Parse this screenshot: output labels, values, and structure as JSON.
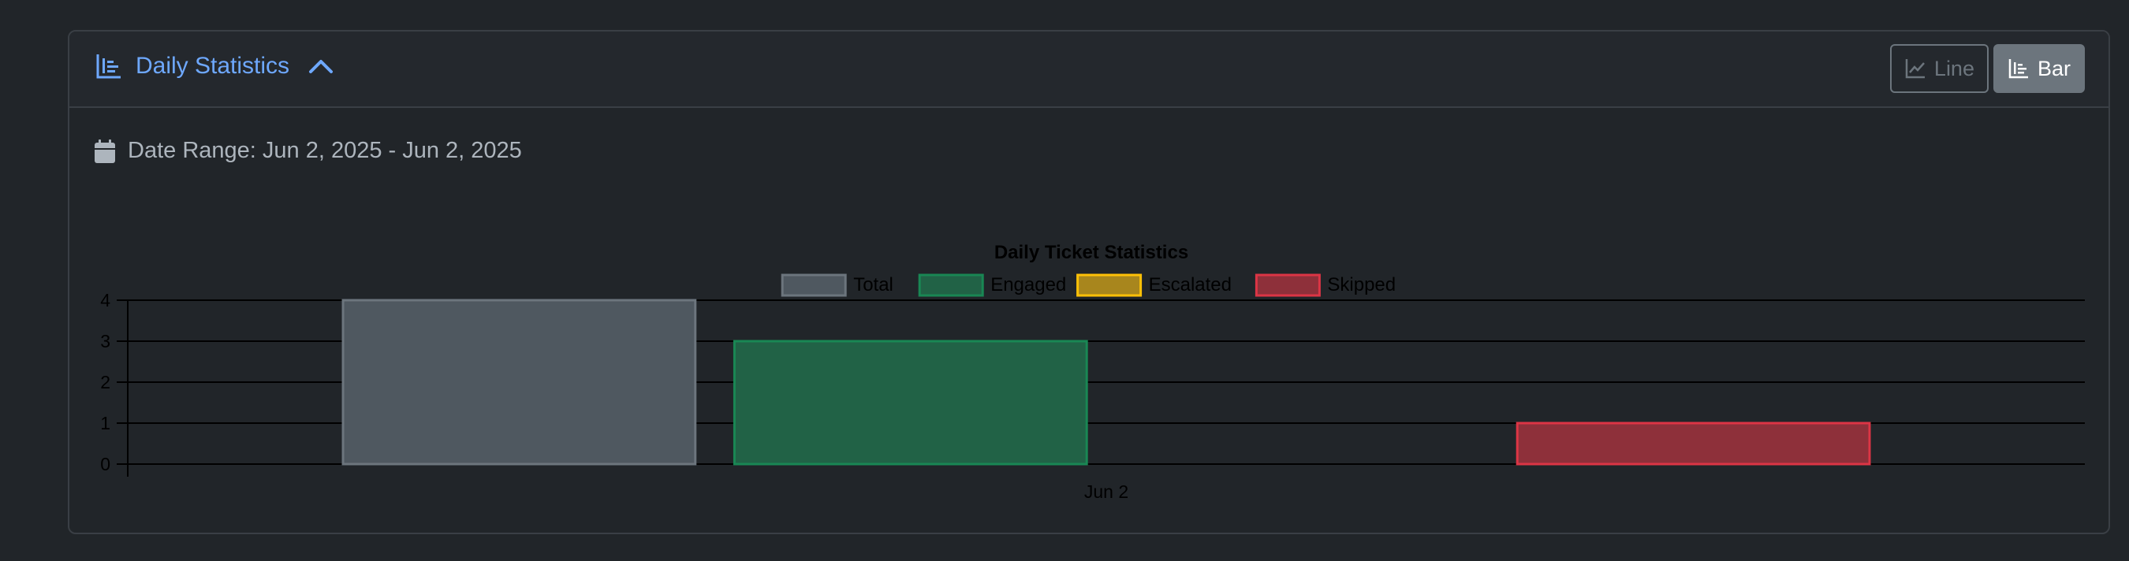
{
  "header": {
    "title": "Daily Statistics",
    "buttons": {
      "line_label": "Line",
      "bar_label": "Bar",
      "active": "bar"
    }
  },
  "date_range": {
    "text": "Date Range: Jun 2, 2025 - Jun 2, 2025"
  },
  "icons": {
    "title_icon": "bar-chart-icon",
    "collapse_icon": "chevron-up-icon",
    "line_icon": "line-chart-icon",
    "bar_icon": "bar-chart-icon",
    "date_icon": "calendar-icon"
  },
  "chart_data": {
    "type": "bar",
    "title": "Daily Ticket Statistics",
    "categories": [
      "Jun 2"
    ],
    "series": [
      {
        "name": "Total",
        "values": [
          4
        ],
        "fill": "#4f5860",
        "stroke": "#6c757d"
      },
      {
        "name": "Engaged",
        "values": [
          3
        ],
        "fill": "#216246",
        "stroke": "#198754"
      },
      {
        "name": "Escalated",
        "values": [
          0
        ],
        "fill": "#a8861d",
        "stroke": "#ffc107"
      },
      {
        "name": "Skipped",
        "values": [
          1
        ],
        "fill": "#8e303a",
        "stroke": "#dc3545"
      }
    ],
    "ylim": [
      0,
      4
    ],
    "yticks": [
      0,
      1,
      2,
      3,
      4
    ],
    "grid": true,
    "legend_position": "top-center",
    "xlabel": "",
    "ylabel": ""
  }
}
